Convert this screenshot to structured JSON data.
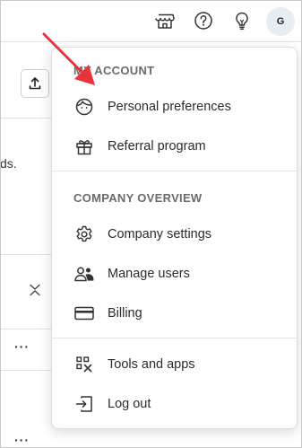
{
  "header": {
    "icons": [
      "shop-icon",
      "help-icon",
      "lightbulb-icon"
    ],
    "avatar_initial": "G"
  },
  "background": {
    "truncated_text": "ds."
  },
  "menu": {
    "my_account_title": "MY ACCOUNT",
    "my_account_items": [
      {
        "label": "Personal preferences",
        "icon": "face-icon"
      },
      {
        "label": "Referral program",
        "icon": "gift-icon"
      }
    ],
    "company_title": "COMPANY OVERVIEW",
    "company_items": [
      {
        "label": "Company settings",
        "icon": "gear-icon"
      },
      {
        "label": "Manage users",
        "icon": "users-icon"
      },
      {
        "label": "Billing",
        "icon": "credit-card-icon"
      }
    ],
    "other_items": [
      {
        "label": "Tools and apps",
        "icon": "tools-icon"
      },
      {
        "label": "Log out",
        "icon": "logout-icon"
      }
    ]
  },
  "colors": {
    "annotation_arrow": "#e8323c",
    "section_title": "#6b6b6b",
    "avatar_bg": "#e8ecf3"
  }
}
